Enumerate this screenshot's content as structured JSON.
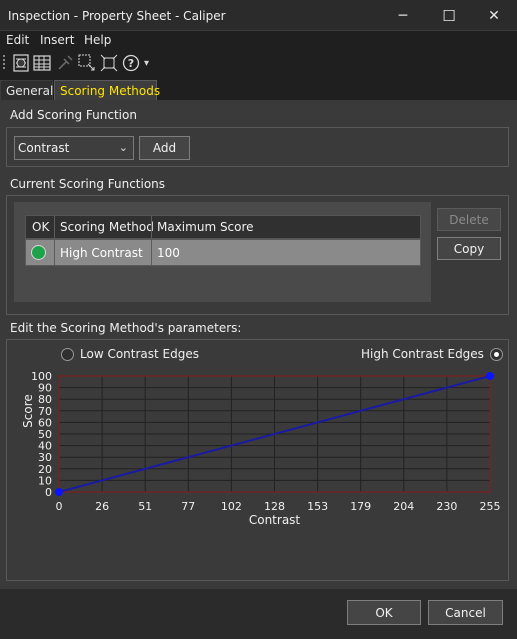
{
  "window": {
    "title": "Inspection - Property Sheet - Caliper",
    "minimize_glyph": "─",
    "maximize_glyph": "☐",
    "close_glyph": "✕"
  },
  "menu": [
    "Edit",
    "Insert",
    "Help"
  ],
  "toolbar_icons": [
    "dollar-sheet-icon",
    "grid-sheet-icon",
    "tools-icon",
    "select-region-icon",
    "fit-region-icon",
    "help-icon",
    "overflow-icon"
  ],
  "toolbar": {
    "help_glyph": "?",
    "overflow_glyph": "▾"
  },
  "tabs": [
    {
      "label": "General",
      "active": false
    },
    {
      "label": "Scoring Methods",
      "active": true
    }
  ],
  "add_section": {
    "label": "Add Scoring Function",
    "selected": "Contrast",
    "chevron": "⌄",
    "add_label": "Add"
  },
  "current_section": {
    "label": "Current Scoring Functions",
    "columns": [
      "OK",
      "Scoring Method",
      "Maximum Score"
    ],
    "rows": [
      {
        "ok": true,
        "method": "High Contrast",
        "max_score": "100"
      }
    ],
    "delete_label": "Delete",
    "copy_label": "Copy"
  },
  "edit_section": {
    "label": "Edit the Scoring Method's parameters:",
    "low_label": "Low Contrast Edges",
    "high_label": "High Contrast Edges",
    "selected": "high"
  },
  "chart_data": {
    "type": "line",
    "xlabel": "Contrast",
    "ylabel": "Score",
    "xlim": [
      0,
      255
    ],
    "ylim": [
      0,
      100
    ],
    "x_ticks": [
      "0",
      "26",
      "51",
      "77",
      "102",
      "128",
      "153",
      "179",
      "204",
      "230",
      "255"
    ],
    "y_ticks": [
      "0",
      "10",
      "20",
      "30",
      "40",
      "50",
      "60",
      "70",
      "80",
      "90",
      "100"
    ],
    "grid": true,
    "series": [
      {
        "x": [
          0,
          255
        ],
        "y": [
          0,
          100
        ]
      }
    ],
    "colors": {
      "line": "#1a1aa6",
      "point": "#0a14ff",
      "frame": "#8b1a1a",
      "grid": "#222222",
      "plot_bg": "#3b3b3b"
    }
  },
  "footer": {
    "ok_label": "OK",
    "cancel_label": "Cancel"
  },
  "colors": {
    "active_tab_text": "#ffe500",
    "ok_green": "#1fa34a"
  }
}
